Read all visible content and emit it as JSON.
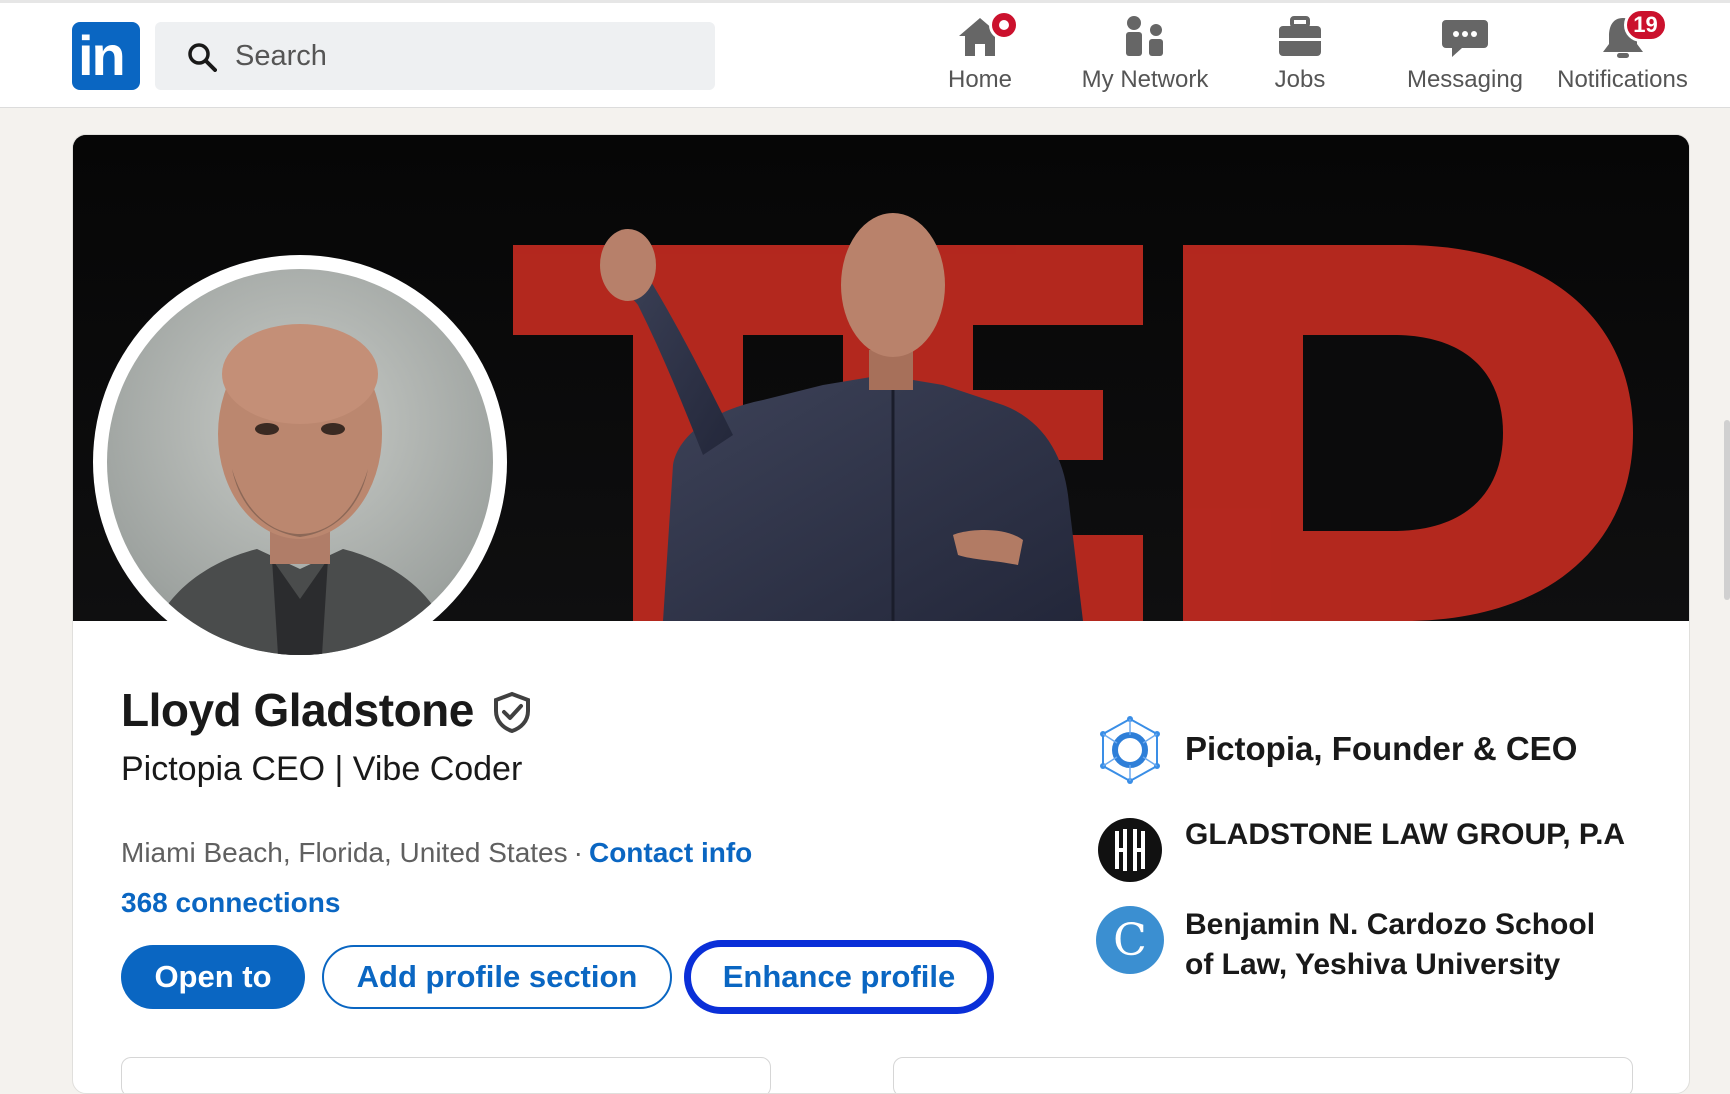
{
  "nav": {
    "search_placeholder": "Search",
    "items": [
      {
        "label": "Home",
        "icon": "home-icon"
      },
      {
        "label": "My Network",
        "icon": "network-icon"
      },
      {
        "label": "Jobs",
        "icon": "briefcase-icon"
      },
      {
        "label": "Messaging",
        "icon": "message-icon"
      },
      {
        "label": "Notifications",
        "icon": "bell-icon",
        "badge": "19"
      }
    ],
    "logo_text": "in"
  },
  "profile": {
    "name": "Lloyd Gladstone",
    "headline": "Pictopia CEO | Vibe Coder",
    "location": "Miami Beach, Florida, United States",
    "separator": "·",
    "contact_label": "Contact info",
    "connections": "368 connections",
    "banner_text": "TED"
  },
  "actions": {
    "open_to": "Open to",
    "add_section": "Add profile section",
    "enhance": "Enhance profile"
  },
  "experience": [
    {
      "label": "Pictopia, Founder & CEO"
    },
    {
      "label": "GLADSTONE LAW GROUP, P.A"
    },
    {
      "line1": "Benjamin N. Cardozo School",
      "line2": "of Law, Yeshiva University",
      "logo_letter": "C"
    }
  ],
  "colors": {
    "brand": "#0a66c2",
    "badge": "#cb112d",
    "focus": "#0a2fd8",
    "banner_red": "#c0291f"
  }
}
